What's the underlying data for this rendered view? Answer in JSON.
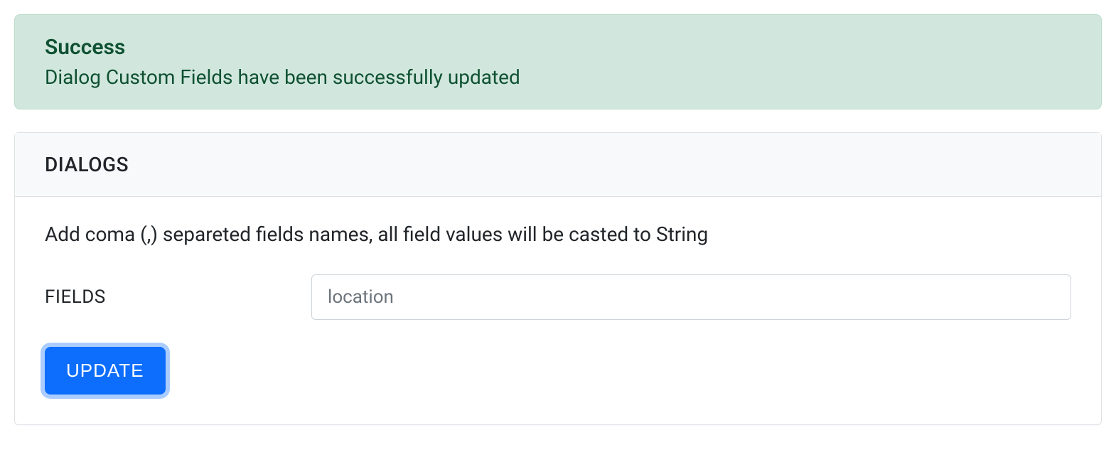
{
  "alert": {
    "title": "Success",
    "message": "Dialog Custom Fields have been successfully updated"
  },
  "card": {
    "header_title": "DIALOGS",
    "help_text": "Add coma (,) separeted fields names, all field values will be casted to String",
    "fields_label": "FIELDS",
    "fields_value": "location",
    "update_button_label": "UPDATE"
  }
}
